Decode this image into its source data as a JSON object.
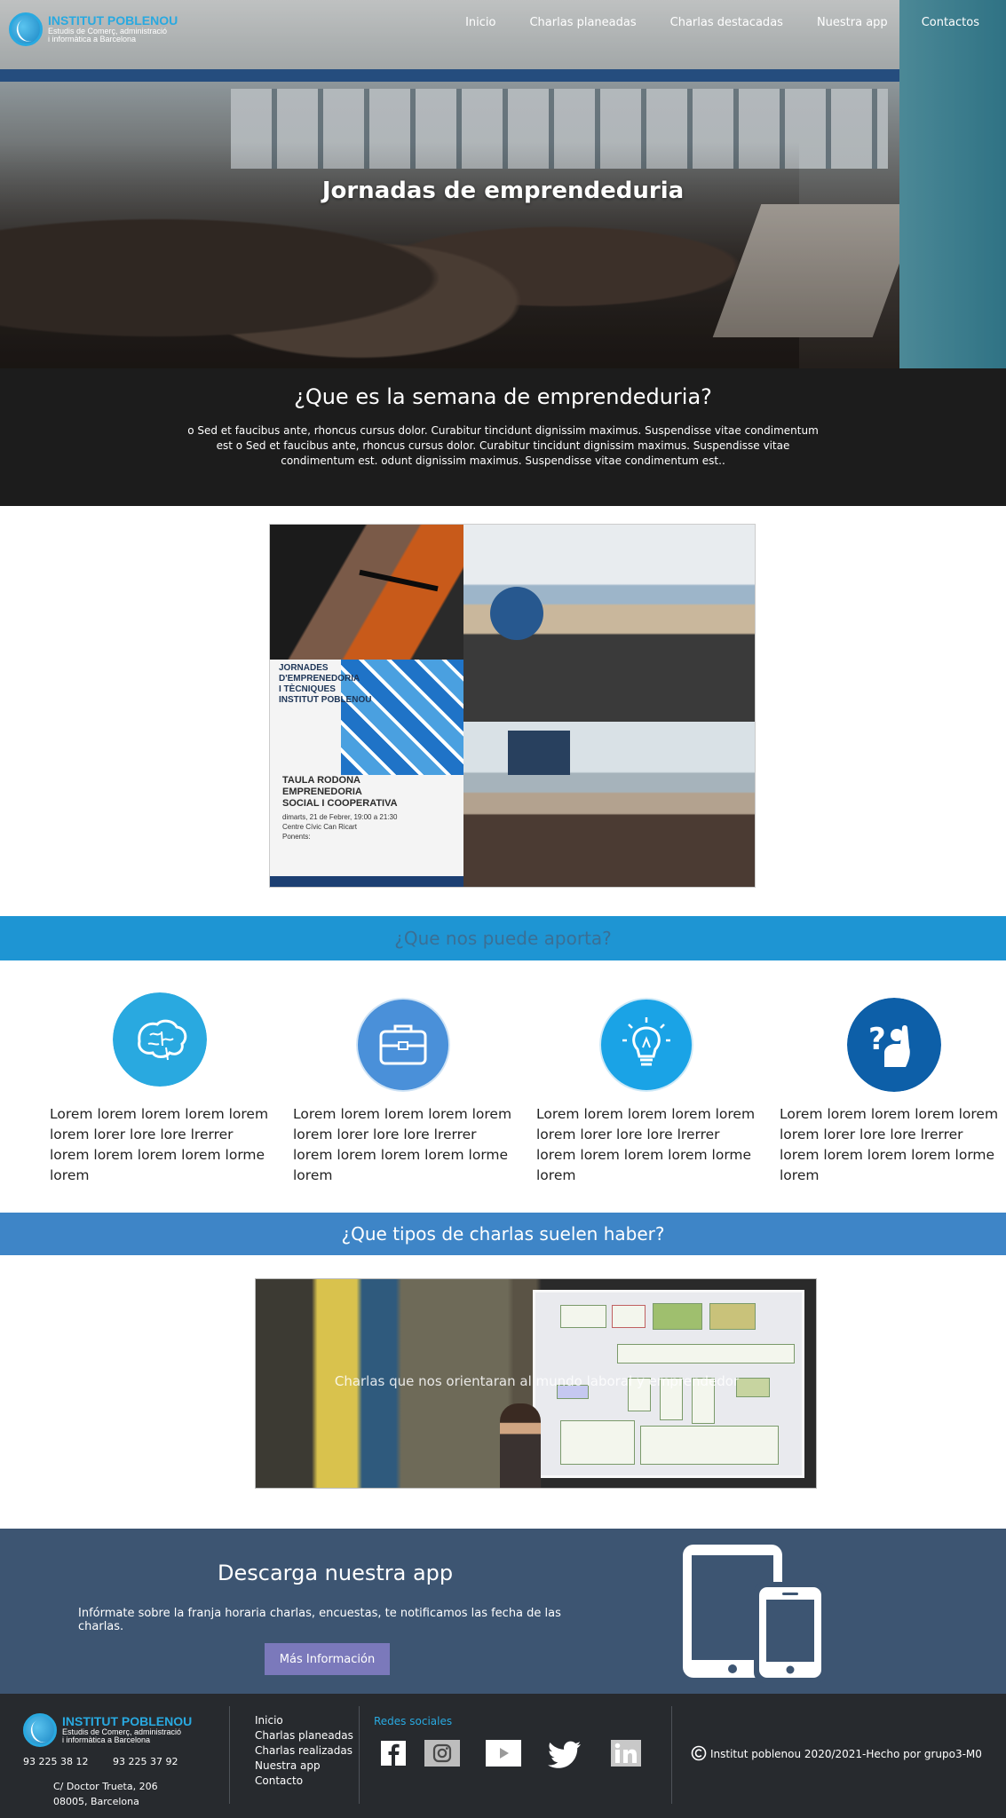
{
  "brand": {
    "name": "INSTITUT POBLENOU",
    "sub_line1": "Estudis de Comerç, administració",
    "sub_line2": "i informàtica a Barcelona"
  },
  "nav": {
    "items": [
      "Inicio",
      "Charlas planeadas",
      "Charlas destacadas",
      "Nuestra app",
      "Contactos"
    ]
  },
  "hero": {
    "title": "Jornadas de emprendeduria"
  },
  "what": {
    "heading": "¿Que es la semana de emprendeduria?",
    "body": "o Sed et faucibus ante, rhoncus cursus dolor. Curabitur tincidunt dignissim maximus. Suspendisse vitae condimentum est o Sed et faucibus ante, rhoncus cursus dolor. Curabitur tincidunt dignissim maximus. Suspendisse vitae condimentum est. odunt dignissim maximus. Suspendisse vitae condimentum est.."
  },
  "poster": {
    "line1": "JORNADES",
    "line2": "D'EMPRENEDORIA",
    "line3": "I TÈCNIQUES",
    "line4": "INSTITUT POBLENOU",
    "main1": "TAULA RODONA",
    "main2": "EMPRENEDORIA",
    "main3": "SOCIAL I COOPERATIVA",
    "date": "dimarts, 21 de Febrer, 19:00 a 21:30",
    "venue": "Centre Cívic Can Ricart",
    "speakers": "Ponents:"
  },
  "aporta": {
    "heading": "¿Que nos puede aporta?"
  },
  "features": [
    {
      "icon": "brain-icon",
      "text": "Lorem lorem lorem lorem lorem lorem lorer lore lore lrerrer lorem lorem lorem lorem lorme lorem"
    },
    {
      "icon": "briefcase-icon",
      "text": "Lorem lorem lorem lorem lorem lorem lorer lore lore lrerrer lorem lorem lorem lorem lorme lorem"
    },
    {
      "icon": "lightbulb-icon",
      "text": "Lorem lorem lorem lorem lorem lorem lorer lore lore lrerrer lorem lorem lorem lorem lorme lorem"
    },
    {
      "icon": "question-hand-icon",
      "text": "Lorem lorem lorem lorem lorem lorem lorer lore lore lrerrer lorem lorem lorem lorem lorme lorem"
    }
  ],
  "tipos": {
    "heading": "¿Que tipos de charlas suelen haber?",
    "caption": "Charlas que nos orientaran al mundo laboral y emprendedor"
  },
  "app": {
    "heading": "Descarga nuestra app",
    "text": "Infórmate sobre la franja horaria charlas, encuestas, te notificamos las fecha de las charlas.",
    "button": "Más Información"
  },
  "footer": {
    "phone1": "93 225 38 12",
    "phone2": "93 225 37 92",
    "address1": "C/ Doctor Trueta, 206",
    "address2": "08005, Barcelona",
    "links": [
      "Inicio",
      "Charlas planeadas",
      "Charlas realizadas",
      "Nuestra app",
      "Contacto"
    ],
    "social_label": "Redes sociales",
    "copyright": "Institut poblenou 2020/2021-Hecho por grupo3-M0"
  },
  "colors": {
    "accent": "#29a9e0",
    "aporta_band": "#1e95d3",
    "tipos_band": "#3e85c7",
    "app_bg": "#3d5572",
    "button": "#7b79bb",
    "footer_bg": "#272a2e"
  }
}
